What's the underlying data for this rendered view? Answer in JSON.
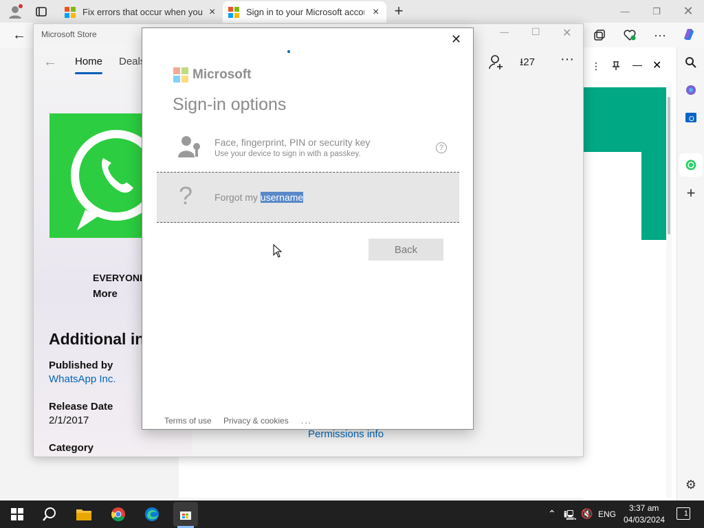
{
  "browser": {
    "tabs": [
      {
        "title": "Fix errors that occur when you st"
      },
      {
        "title": "Sign in to your Microsoft accoun"
      }
    ],
    "downloads_count": "27"
  },
  "store": {
    "window_title": "Microsoft Store",
    "nav": {
      "home": "Home",
      "deals": "Deals"
    },
    "rating": "EVERYONE",
    "more": "More",
    "section_title": "Additional in",
    "published_by_label": "Published by",
    "publisher": "WhatsApp Inc.",
    "release_date_label": "Release Date",
    "release_date": "2/1/2017",
    "category_label": "Category",
    "permissions_link": "Permissions info"
  },
  "dialog": {
    "brand": "Microsoft",
    "heading": "Sign-in options",
    "option_passkey": {
      "title": "Face, fingerprint, PIN or security key",
      "subtitle": "Use your device to sign in with a passkey."
    },
    "option_forgot": {
      "text_prefix": "Forgot my",
      "text_selected": "username"
    },
    "back_label": "Back",
    "footer": {
      "terms": "Terms of use",
      "privacy": "Privacy & cookies",
      "more": "..."
    }
  },
  "taskbar": {
    "language": "ENG",
    "time": "3:37 am",
    "date": "04/03/2024",
    "notification_count": "1"
  },
  "colors": {
    "whatsapp_green": "#2ccd40",
    "accent_green": "#00a884",
    "link_blue": "#0067b8",
    "selection": "#5a88c8"
  }
}
